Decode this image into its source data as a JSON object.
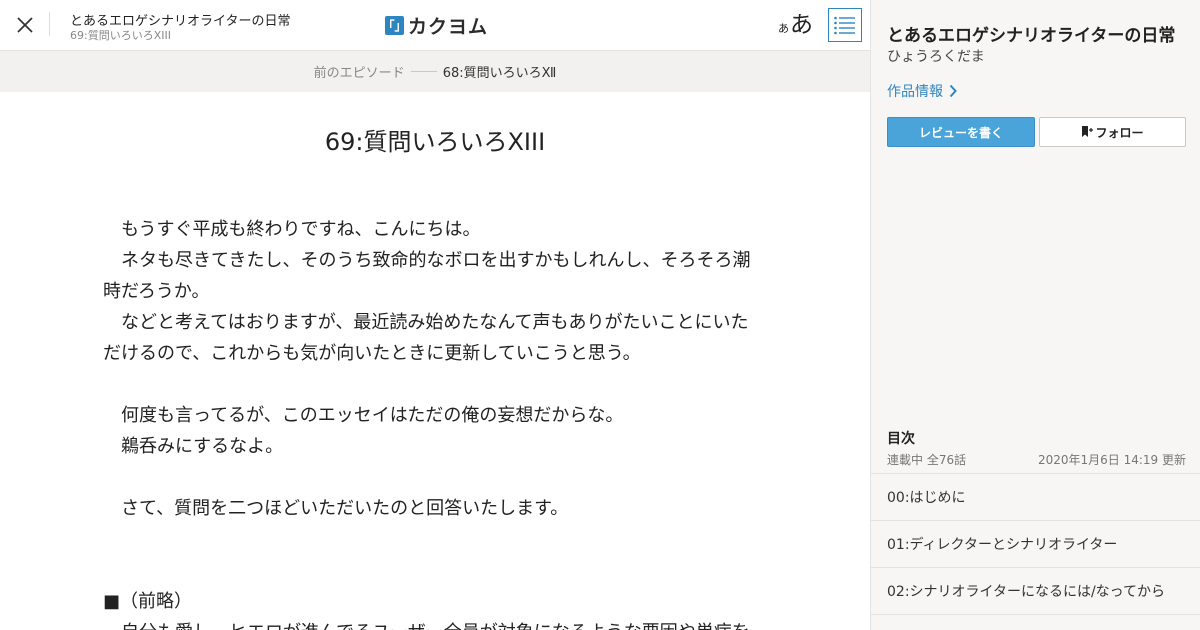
{
  "header": {
    "work_title": "とあるエロゲシナリオライターの日常",
    "episode_subtitle": "69:質問いろいろXIII",
    "logo_mark": "「」",
    "logo_text": "カクヨム",
    "font_size_small": "あ",
    "font_size_large": "あ",
    "icons": {
      "close": "close-icon",
      "toc": "list-icon"
    }
  },
  "episode_nav": {
    "prev_label": "前のエピソード",
    "prev_title": "68:質問いろいろⅫ"
  },
  "main": {
    "episode_title": "69:質問いろいろXIII",
    "paragraphs": [
      "　もうすぐ平成も終わりですね、こんにちは。",
      "　ネタも尽きてきたし、そのうち致命的なボロを出すかもしれんし、そろそろ潮時だろうか。",
      "　などと考えてはおりますが、最近読み始めたなんて声もありがたいことにいただけるので、これからも気が向いたときに更新していこうと思う。",
      "",
      "　何度も言ってるが、このエッセイはただの俺の妄想だからな。",
      "　鵜呑みにするなよ。",
      "",
      "　さて、質問を二つほどいただいたのと回答いたします。",
      "",
      "",
      "■（前略）",
      "　自分も愛し、ヒエロが進んでるユーザー全員が対象になるような要因や単病を"
    ]
  },
  "sidebar": {
    "work_title": "とあるエロゲシナリオライターの日常",
    "author": "ひょうろくだま",
    "info_link": "作品情報",
    "review_button": "レビューを書く",
    "follow_button": "フォロー",
    "toc_heading": "目次",
    "toc_status": "連載中 全76話",
    "toc_updated": "2020年1月6日 14:19 更新",
    "toc_items": [
      "00:はじめに",
      "01:ディレクターとシナリオライター",
      "02:シナリオライターになるには/なってから"
    ]
  },
  "colors": {
    "accent": "#2e86c1",
    "review_button_bg": "#4aa3d9",
    "nav_bar_bg": "#f2f1ef",
    "sidebar_bg": "#f7f6f5"
  }
}
